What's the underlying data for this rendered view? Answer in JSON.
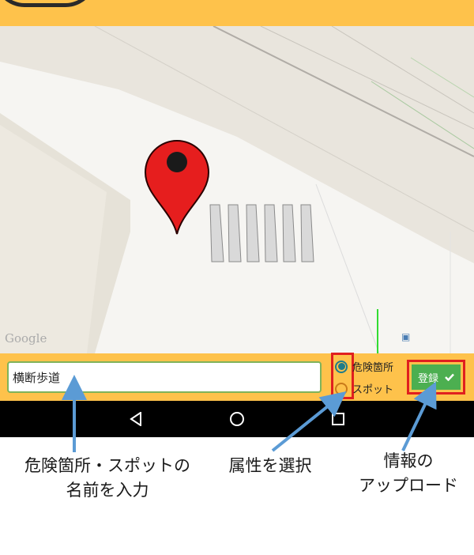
{
  "map": {
    "attribution": "Google",
    "bus_stop_icon": "bus-stop-icon"
  },
  "form": {
    "name_value": "横断歩道",
    "attributes": [
      {
        "label": "危険箇所",
        "selected": true
      },
      {
        "label": "スポット",
        "selected": false
      }
    ],
    "register_label": "登録",
    "register_icon": "checkmark-icon"
  },
  "navbar": {
    "back_icon": "back-triangle-icon",
    "home_icon": "home-circle-icon",
    "recents_icon": "recents-square-icon"
  },
  "annotations": {
    "name": {
      "line1": "危険箇所・スポットの",
      "line2": "名前を入力"
    },
    "attribute": {
      "line1": "属性を選択"
    },
    "upload": {
      "line1": "情報の",
      "line2": "アップロード"
    }
  },
  "colors": {
    "accent": "#fec24b",
    "highlight": "#e01f1f",
    "register": "#4caf50",
    "arrow": "#5b9bd5",
    "pin": "#e61e1e"
  }
}
